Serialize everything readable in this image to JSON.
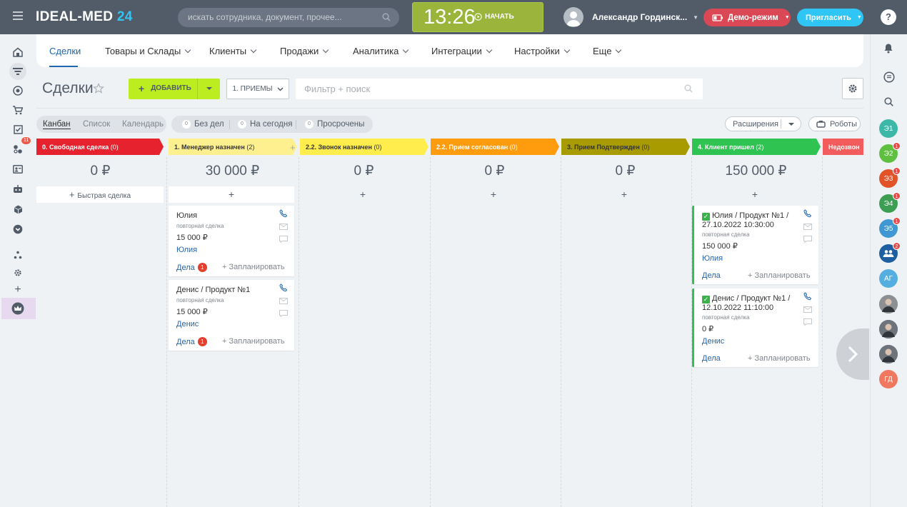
{
  "topbar": {
    "logo_main": "IDEAL-MED",
    "logo_num": "24",
    "search_placeholder": "искать сотрудника, документ, прочее...",
    "clock": "13:26",
    "start_label": "НАЧАТЬ",
    "user_name": "Александр Гординск...",
    "demo_label": "Демо-режим",
    "invite_label": "Пригласить",
    "help_label": "?"
  },
  "left_nav": [
    {
      "icon": "home-icon"
    },
    {
      "icon": "filter-icon",
      "active": true
    },
    {
      "icon": "target-icon"
    },
    {
      "icon": "cart-icon"
    },
    {
      "icon": "checkbox-icon"
    },
    {
      "icon": "puzzle-icon",
      "badge": "11"
    },
    {
      "icon": "contact-card-icon"
    },
    {
      "icon": "robot-icon"
    },
    {
      "icon": "box-icon"
    },
    {
      "icon": "chevron-circle-icon"
    },
    {
      "icon": "sitemap-icon"
    },
    {
      "icon": "gear-icon"
    },
    {
      "icon": "plus-icon"
    },
    {
      "icon": "crown-icon",
      "active": true
    }
  ],
  "main_nav": {
    "tabs": [
      {
        "label": "Сделки",
        "active": true
      },
      {
        "label": "Товары и Склады",
        "dropdown": true
      },
      {
        "label": "Клиенты",
        "dropdown": true
      },
      {
        "label": "Продажи",
        "dropdown": true
      },
      {
        "label": "Аналитика",
        "dropdown": true
      },
      {
        "label": "Интеграции",
        "dropdown": true
      },
      {
        "label": "Настройки",
        "dropdown": true
      },
      {
        "label": "Еще",
        "dropdown": true
      }
    ]
  },
  "toolbar": {
    "title": "Сделки",
    "add_label": "ДОБАВИТЬ",
    "pipeline_label": "1. ПРИЕМЫ",
    "filter_placeholder": "Фильтр + поиск"
  },
  "views": [
    "Канбан",
    "Список",
    "Календарь"
  ],
  "counters": [
    {
      "count": "0",
      "label": "Без дел"
    },
    {
      "count": "0",
      "label": "На сегодня"
    },
    {
      "count": "0",
      "label": "Просрочены"
    }
  ],
  "extensions_label": "Расширения",
  "robots_label": "Роботы",
  "quick_deal_label": "Быстрая сделка",
  "columns": [
    {
      "name": "0. Свободная сделка",
      "count": "(0)",
      "color": "#e5222e",
      "text_color": "#ffffff",
      "sum": "0 ₽",
      "cards": []
    },
    {
      "name": "1. Менеджер назначен",
      "count": "(2)",
      "color": "#fff08f",
      "text_color": "#333333",
      "sum": "30 000 ₽",
      "cards": [
        {
          "title": "Юлия",
          "type": "повторная сделка",
          "amount": "15 000 ₽",
          "contact": "Юлия",
          "tasks": "Дела",
          "tasks_badge": "1",
          "plan": "+ Запланировать"
        },
        {
          "title": "Денис / Продукт №1",
          "type": "повторная сделка",
          "amount": "15 000 ₽",
          "contact": "Денис",
          "tasks": "Дела",
          "tasks_badge": "1",
          "plan": "+ Запланировать"
        }
      ]
    },
    {
      "name": "2.2. Звонок назначен",
      "count": "(0)",
      "color": "#ffed4d",
      "text_color": "#333333",
      "sum": "0 ₽",
      "cards": []
    },
    {
      "name": "2.2. Прием согласован",
      "count": "(0)",
      "color": "#ff9c0e",
      "text_color": "#ffffff",
      "sum": "0 ₽",
      "cards": []
    },
    {
      "name": "3. Прием Подтвержден",
      "count": "(0)",
      "color": "#a89b00",
      "text_color": "#333333",
      "sum": "0 ₽",
      "cards": []
    },
    {
      "name": "4. Клиент пришел",
      "count": "(2)",
      "color": "#2fc451",
      "text_color": "#ffffff",
      "sum": "150 000 ₽",
      "cards": [
        {
          "title": "Юлия / Продукт №1 / 27.10.2022 10:30:00",
          "type": "повторная сделка",
          "amount": "150 000 ₽",
          "contact": "Юлия",
          "tasks": "Дела",
          "plan": "+ Запланировать"
        },
        {
          "title": "Денис / Продукт №1 / 12.10.2022 11:10:00",
          "type": "повторная сделка",
          "amount": "0 ₽",
          "contact": "Денис",
          "tasks": "Дела",
          "plan": "+ Запланировать"
        }
      ]
    },
    {
      "name": "Недозвон",
      "count": "",
      "color": "#f25c5c",
      "text_color": "#ffffff",
      "sum": "",
      "cards": []
    }
  ],
  "right_bar": {
    "avatars": [
      {
        "label": "Э1",
        "color": "#3bb8a7"
      },
      {
        "label": "Э2",
        "color": "#5fbf3e",
        "badge": "1"
      },
      {
        "label": "Э3",
        "color": "#e2532a",
        "badge": "1"
      },
      {
        "label": "Э4",
        "color": "#3c9e52",
        "badge": "1"
      },
      {
        "label": "Э5",
        "color": "#3f97d4",
        "badge": "1"
      },
      {
        "label": "",
        "color": "#1d5fa0",
        "badge": "2",
        "icon": "group-chat-icon"
      },
      {
        "label": "АГ",
        "color": "#55aee0"
      },
      {
        "label": "",
        "color": "#8d8f92",
        "icon": "user-photo-icon"
      },
      {
        "label": "",
        "color": "#6d747c",
        "icon": "user-photo-icon"
      },
      {
        "label": "",
        "color": "#6d747c",
        "icon": "user-photo-icon"
      },
      {
        "label": "ГД",
        "color": "#f07860"
      }
    ]
  }
}
